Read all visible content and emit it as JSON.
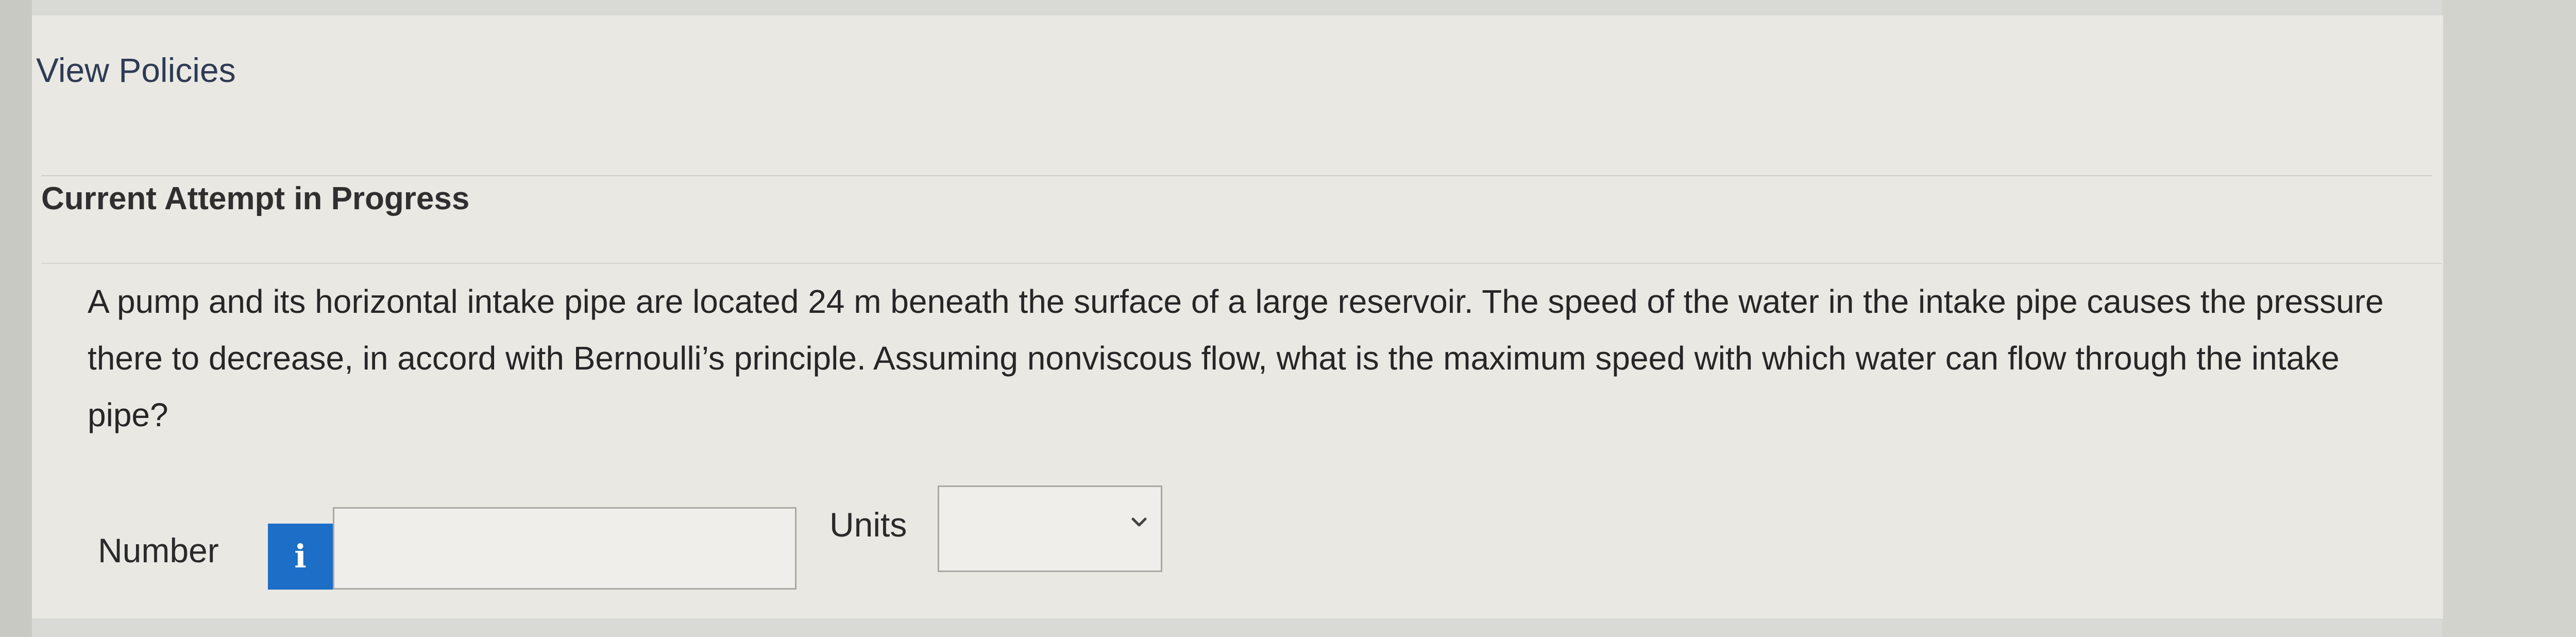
{
  "nav": {
    "view_policies": "View Policies"
  },
  "attempt": {
    "status_label": "Current Attempt in Progress"
  },
  "question": {
    "text": "A pump and its horizontal intake pipe are located 24 m beneath the surface of a large reservoir. The speed of the water in the intake pipe causes the pressure there to decrease, in accord with Bernoulli’s principle. Assuming nonviscous flow, what is the maximum speed with which water can flow through the intake pipe?"
  },
  "answer": {
    "number_label": "Number",
    "info_button": "i",
    "number_value": "",
    "units_label": "Units",
    "units_selected": ""
  },
  "colors": {
    "info_button_bg": "#1c6ec6",
    "link_text": "#2f3b54",
    "panel_bg": "#e9e8e3"
  },
  "icons": {
    "info": "info-icon",
    "dropdown": "chevron-down-icon"
  }
}
